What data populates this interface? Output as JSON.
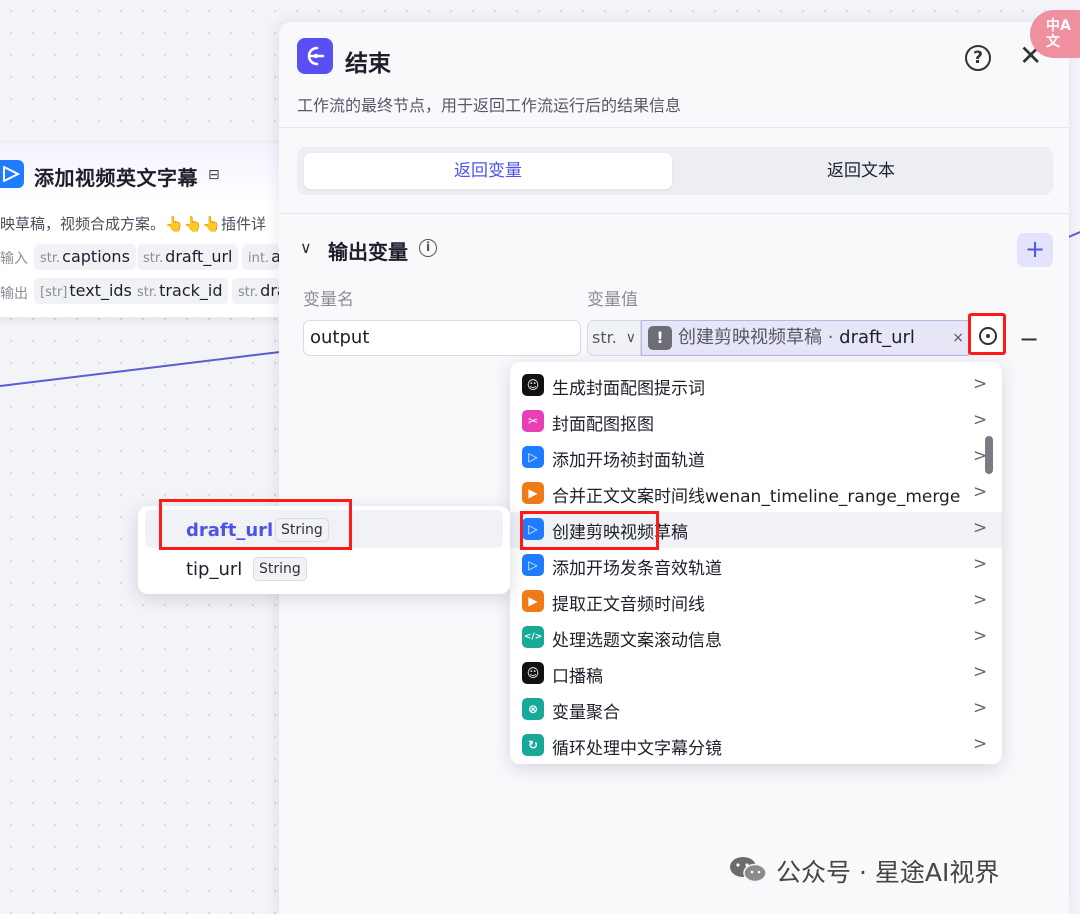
{
  "canvas_node": {
    "title": "添加视频英文字幕",
    "title_icon": "⊟",
    "description": "映草稿，视频合成方案。👆👆👆插件详",
    "input_label": "输入",
    "output_label": "输出",
    "inputs": [
      {
        "type": "str.",
        "name": "captions"
      },
      {
        "type": "str.",
        "name": "draft_url"
      },
      {
        "type": "int.",
        "name": "a"
      }
    ],
    "outputs": [
      {
        "type": "[str]",
        "name": "text_ids"
      },
      {
        "type": "str.",
        "name": "track_id"
      },
      {
        "type": "str.",
        "name": "dra"
      }
    ]
  },
  "panel": {
    "title": "结束",
    "help_glyph": "?",
    "close_glyph": "✕",
    "description": "工作流的最终节点，用于返回工作流运行后的结果信息",
    "tabs": {
      "active": "返回变量",
      "inactive": "返回文本"
    },
    "section": {
      "chevron": "∨",
      "title": "输出变量",
      "info_glyph": "i",
      "add_glyph": "+"
    },
    "columns": {
      "name": "变量名",
      "value": "变量值"
    },
    "row": {
      "name_value": "output",
      "type": "str.",
      "type_arrow": "∨",
      "bang": "!",
      "ref_node": "创建剪映视频草稿 · ",
      "ref_field": "draft_url",
      "clear_glyph": "×",
      "remove_glyph": "−"
    }
  },
  "translate_badge": {
    "line1": "中A",
    "line2": "文"
  },
  "dropdown": {
    "chevron": ">",
    "items": [
      {
        "label": "生成封面配图提示词",
        "icon": "robot-icon",
        "color": "#111111",
        "glyph": "☺"
      },
      {
        "label": "封面配图抠图",
        "icon": "image-cutout-icon",
        "color": "#e83fb7",
        "glyph": "✂"
      },
      {
        "label": "添加开场祯封面轨道",
        "icon": "video-play-icon",
        "color": "#1f7cff",
        "glyph": "▷"
      },
      {
        "label": "合并正文文案时间线wenan_timeline_range_merge",
        "icon": "plugin-icon",
        "color": "#f07a16",
        "glyph": "▶"
      },
      {
        "label": "创建剪映视频草稿",
        "icon": "video-play-icon",
        "color": "#1f7cff",
        "glyph": "▷"
      },
      {
        "label": "添加开场发条音效轨道",
        "icon": "video-play-icon",
        "color": "#1f7cff",
        "glyph": "▷"
      },
      {
        "label": "提取正文音频时间线",
        "icon": "plugin-icon",
        "color": "#f07a16",
        "glyph": "▶"
      },
      {
        "label": "处理选题文案滚动信息",
        "icon": "code-icon",
        "color": "#18a999",
        "glyph": "</>"
      },
      {
        "label": "口播稿",
        "icon": "robot-icon",
        "color": "#111111",
        "glyph": "☺"
      },
      {
        "label": "变量聚合",
        "icon": "aggregate-icon",
        "color": "#18a999",
        "glyph": "⊗"
      },
      {
        "label": "循环处理中文字幕分镜",
        "icon": "loop-icon",
        "color": "#18a999",
        "glyph": "↻"
      }
    ]
  },
  "submenu": {
    "items": [
      {
        "name": "draft_url",
        "type": "String"
      },
      {
        "name": "tip_url",
        "type": "String"
      }
    ]
  },
  "watermark": {
    "text": "公众号 · 星途AI视界"
  },
  "colors": {
    "accent": "#4d53e8",
    "end_icon": "#5a4ff2",
    "highlight_box": "#ff1a1a",
    "edge": "#5a5bd6"
  }
}
